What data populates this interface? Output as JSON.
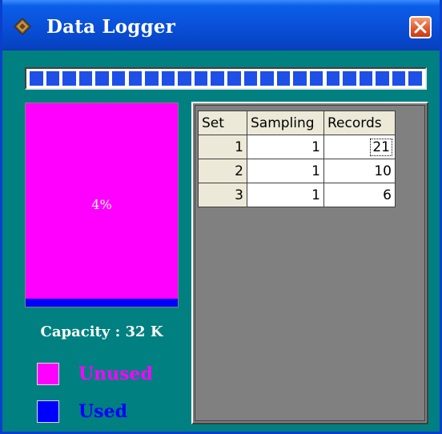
{
  "window": {
    "title": "Data Logger",
    "icon": "data-logger-app-icon",
    "close_icon": "close-icon"
  },
  "progress": {
    "segments": 24,
    "fill_fraction": 1.0,
    "color": "#1e4fe6"
  },
  "memory": {
    "percent_label": "4%",
    "used_fraction": 0.04,
    "unused_color": "#ff00ff",
    "used_color": "#0000ff"
  },
  "capacity_label": "Capacity : 32 K",
  "legend": {
    "unused_label": "Unused",
    "used_label": "Used"
  },
  "table": {
    "columns": [
      "Set",
      "Sampling",
      "Records"
    ],
    "rows": [
      {
        "set": "1",
        "sampling": "1",
        "records": "21"
      },
      {
        "set": "2",
        "sampling": "1",
        "records": "10"
      },
      {
        "set": "3",
        "sampling": "1",
        "records": "6"
      }
    ]
  }
}
